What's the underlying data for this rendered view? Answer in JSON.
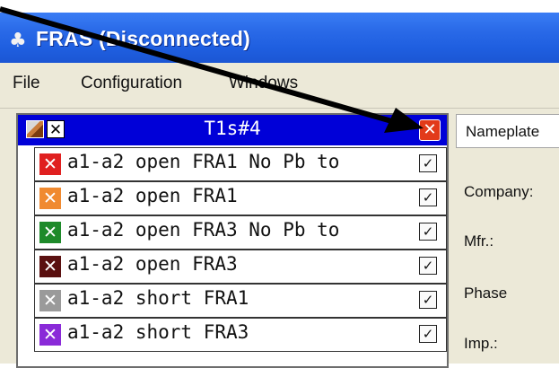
{
  "window": {
    "title": "FRAS (Disconnected)",
    "title_bar_color": "#1f5fe0"
  },
  "menu": {
    "items": [
      "File",
      "Configuration",
      "Windows"
    ]
  },
  "tree": {
    "header_title": "T1s#4",
    "header_color": "#0000d8",
    "close_color": "#e23a1a",
    "rows": [
      {
        "label": "a1-a2 open FRA1 No Pb to",
        "color": "#e02020",
        "checked": true
      },
      {
        "label": "a1-a2 open FRA1",
        "color": "#f08a30",
        "checked": true
      },
      {
        "label": "a1-a2 open FRA3 No Pb to",
        "color": "#1e8a2a",
        "checked": true
      },
      {
        "label": "a1-a2 open FRA3",
        "color": "#5a1010",
        "checked": true
      },
      {
        "label": "a1-a2 short FRA1",
        "color": "#9a9a9a",
        "checked": true
      },
      {
        "label": "a1-a2 short FRA3",
        "color": "#8a2ad8",
        "checked": true
      }
    ]
  },
  "properties": {
    "tab_label": "Nameplate",
    "fields": [
      "Company:",
      "Mfr.:",
      "Phase",
      "Imp.:"
    ]
  },
  "annotation": {
    "arrow_color": "#000000"
  }
}
